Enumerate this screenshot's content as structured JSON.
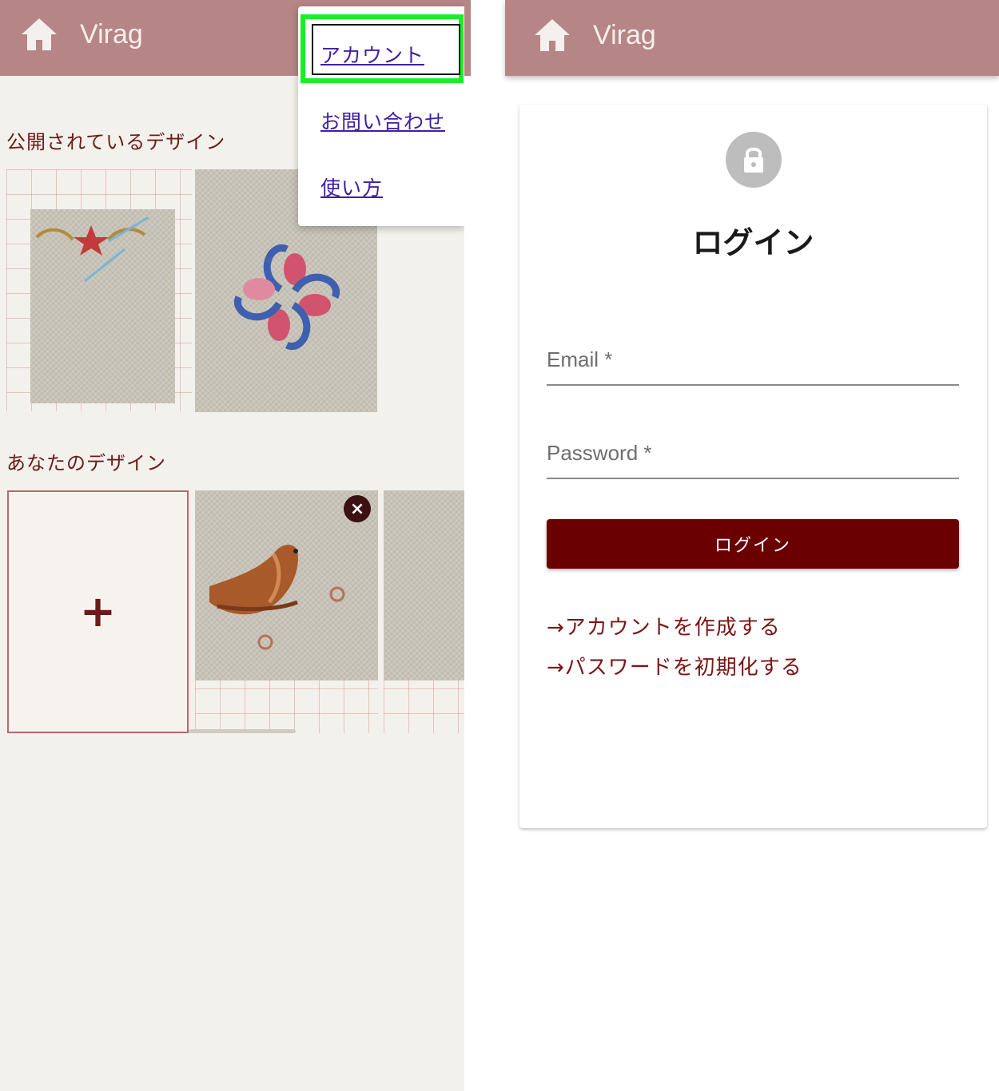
{
  "app": {
    "title": "Virag"
  },
  "left_panel": {
    "public_section_label": "公開されているデザイン",
    "your_section_label": "あなたのデザイン",
    "add_label": "+",
    "delete_label": "×"
  },
  "menu": {
    "items": [
      {
        "label": "アカウント"
      },
      {
        "label": "お問い合わせ"
      },
      {
        "label": "使い方"
      }
    ]
  },
  "login": {
    "heading": "ログイン",
    "email_label": "Email *",
    "email_value": "",
    "password_label": "Password *",
    "password_value": "",
    "submit_label": "ログイン",
    "create_account_link": "→アカウントを作成する",
    "reset_password_link": "→パスワードを初期化する"
  },
  "colors": {
    "appbar": "#b68585",
    "brand_dark": "#6b0000",
    "menu_link": "#3e1fa3",
    "highlight": "#18ef2a"
  },
  "icons": [
    "home-icon",
    "lock-icon",
    "close-icon",
    "plus-icon"
  ]
}
